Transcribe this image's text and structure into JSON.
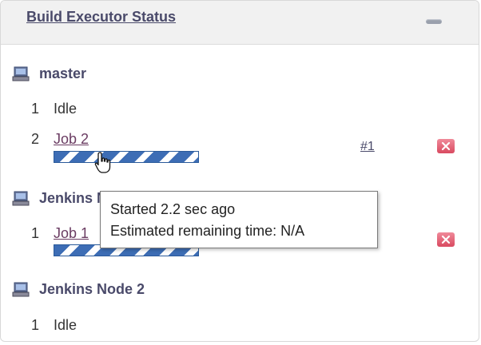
{
  "panel": {
    "title": "Build Executor Status"
  },
  "nodes": [
    {
      "name": "master",
      "executors": [
        {
          "number": "1",
          "status": "Idle"
        },
        {
          "number": "2",
          "job": "Job 2",
          "build": "#1",
          "progress": 0.35
        }
      ]
    },
    {
      "name": "Jenkins Node 1",
      "executors": [
        {
          "number": "1",
          "job": "Job 1",
          "build": "#1",
          "progress": 0.25
        }
      ]
    },
    {
      "name": "Jenkins Node 2",
      "executors": [
        {
          "number": "1",
          "status": "Idle"
        }
      ]
    }
  ],
  "tooltip": {
    "started": "Started 2.2 sec ago",
    "remaining": "Estimated remaining time: N/A"
  },
  "colors": {
    "progress_stripe": "#3d6db5",
    "stop_button": "#d94a60",
    "header_bg": "#f1f1f1"
  },
  "icons": [
    "computer-icon",
    "stop-icon",
    "collapse-icon",
    "hand-cursor-icon"
  ]
}
